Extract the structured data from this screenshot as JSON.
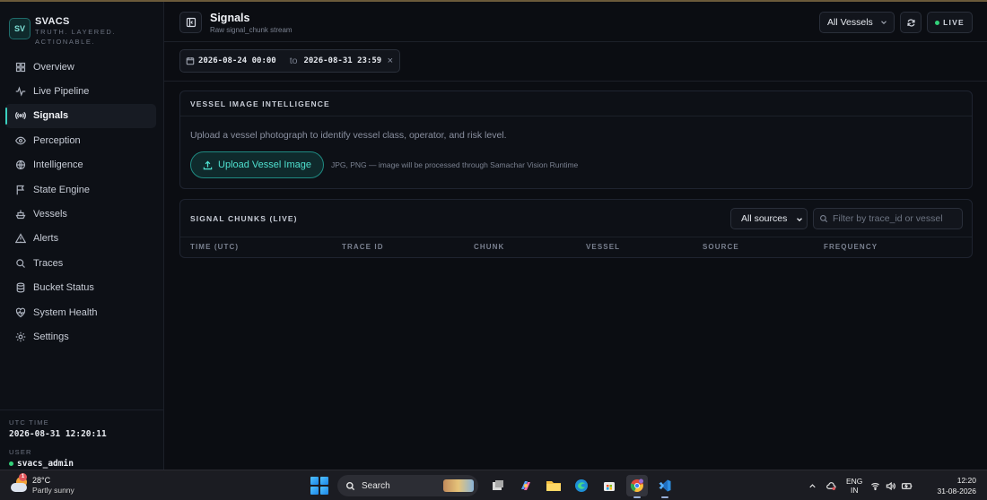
{
  "brand": {
    "initials": "SV",
    "name": "SVACS",
    "tagline_line1": "TRUTH. LAYERED.",
    "tagline_line2": "ACTIONABLE."
  },
  "sidebar": {
    "items": [
      {
        "label": "Overview",
        "icon": "grid-icon",
        "active": false
      },
      {
        "label": "Live Pipeline",
        "icon": "pulse-icon",
        "active": false
      },
      {
        "label": "Signals",
        "icon": "radio-signal-icon",
        "active": true
      },
      {
        "label": "Perception",
        "icon": "eye-icon",
        "active": false
      },
      {
        "label": "Intelligence",
        "icon": "globe-icon",
        "active": false
      },
      {
        "label": "State Engine",
        "icon": "flag-icon",
        "active": false
      },
      {
        "label": "Vessels",
        "icon": "ship-icon",
        "active": false
      },
      {
        "label": "Alerts",
        "icon": "warning-icon",
        "active": false
      },
      {
        "label": "Traces",
        "icon": "search-icon",
        "active": false
      },
      {
        "label": "Bucket Status",
        "icon": "database-icon",
        "active": false
      },
      {
        "label": "System Health",
        "icon": "heart-pulse-icon",
        "active": false
      },
      {
        "label": "Settings",
        "icon": "gear-icon",
        "active": false
      }
    ],
    "footer": {
      "utc_label": "UTC TIME",
      "utc_value": "2026-08-31 12:20:11",
      "user_label": "USER",
      "user_value": "svacs_admin"
    }
  },
  "header": {
    "title": "Signals",
    "subtitle": "Raw signal_chunk stream",
    "vessel_filter": "All Vessels",
    "live_label": "LIVE"
  },
  "date_range": {
    "start": "2026-08-24 00:00",
    "separator": "to",
    "end": "2026-08-31 23:59",
    "clear": "×"
  },
  "image_intel": {
    "heading": "VESSEL IMAGE INTELLIGENCE",
    "description": "Upload a vessel photograph to identify vessel class, operator, and risk level.",
    "upload_label": "Upload Vessel Image",
    "hint": "JPG, PNG — image will be processed through Samachar Vision Runtime"
  },
  "signal_chunks": {
    "heading": "SIGNAL CHUNKS (LIVE)",
    "source_filter": "All sources",
    "search_placeholder": "Filter by trace_id or vessel",
    "columns": [
      "TIME (UTC)",
      "TRACE ID",
      "CHUNK",
      "VESSEL",
      "SOURCE",
      "FREQUENCY"
    ]
  },
  "taskbar": {
    "weather_temp": "28°C",
    "weather_cond": "Partly sunny",
    "weather_badge": "1",
    "search_label": "Search",
    "lang_line1": "ENG",
    "lang_line2": "IN",
    "time": "12:20",
    "date": "31-08-2026"
  },
  "colors": {
    "accent": "#3ad0c0",
    "live_dot": "#33d17a",
    "background": "#0b0d12"
  }
}
